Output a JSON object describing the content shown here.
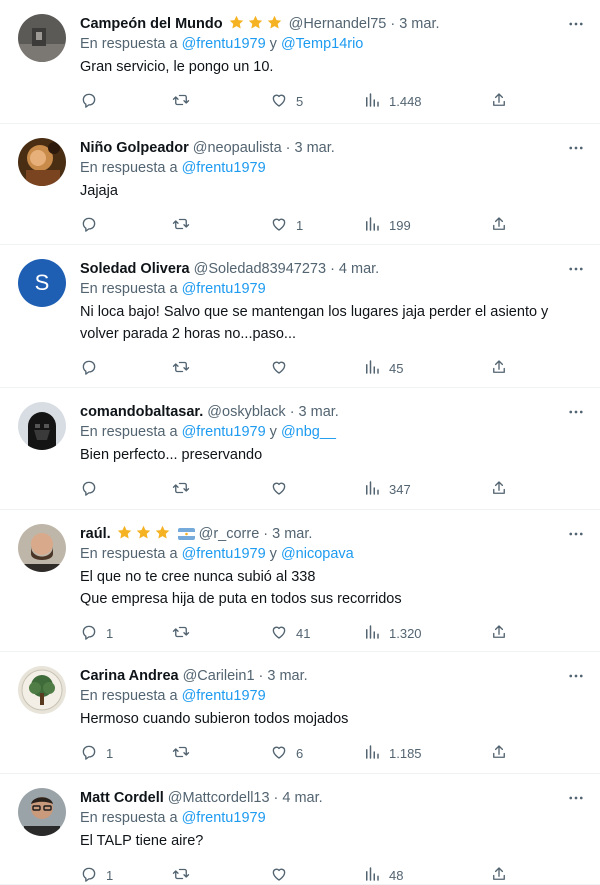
{
  "reply_prefix": "En respuesta a",
  "and_word": "y",
  "dot": "·",
  "tweets": [
    {
      "name": "Campeón del Mundo",
      "stars": 3,
      "flag": false,
      "handle": "@Hernandel75",
      "date": "3 mar.",
      "mention1": "@frentu1979",
      "mention2": "@Temp14rio",
      "text": [
        "Gran servicio, le pongo un 10."
      ],
      "replies": "",
      "retweets": "",
      "likes": "5",
      "views": "1.448",
      "avatar": "photo-dark-gray"
    },
    {
      "name": "Niño Golpeador",
      "stars": 0,
      "flag": false,
      "handle": "@neopaulista",
      "date": "3 mar.",
      "mention1": "@frentu1979",
      "mention2": "",
      "text": [
        "Jajaja"
      ],
      "replies": "",
      "retweets": "",
      "likes": "1",
      "views": "199",
      "avatar": "photo-painting"
    },
    {
      "name": "Soledad Olivera",
      "stars": 0,
      "flag": false,
      "handle": "@Soledad83947273",
      "date": "4 mar.",
      "mention1": "@frentu1979",
      "mention2": "",
      "text": [
        "Ni loca bajo! Salvo que se mantengan los lugares jaja perder el asiento y",
        "volver parada 2 horas no...paso..."
      ],
      "replies": "",
      "retweets": "",
      "likes": "",
      "views": "45",
      "avatar": "letter-S",
      "avatar_letter": "S"
    },
    {
      "name": "comandobaltasar.",
      "stars": 0,
      "flag": false,
      "handle": "@oskyblack",
      "date": "3 mar.",
      "mention1": "@frentu1979",
      "mention2": "@nbg__",
      "text": [
        "Bien perfecto... preservando"
      ],
      "replies": "",
      "retweets": "",
      "likes": "",
      "views": "347",
      "avatar": "photo-darth-vader"
    },
    {
      "name": "raúl.",
      "stars": 3,
      "flag": true,
      "handle": "@r_corre",
      "date": "3 mar.",
      "mention1": "@frentu1979",
      "mention2": "@nicopava",
      "text": [
        "El que no te cree nunca subió al 338",
        "Que empresa hija de puta en todos sus recorridos"
      ],
      "replies": "1",
      "retweets": "",
      "likes": "41",
      "views": "1.320",
      "avatar": "photo-bearded-man"
    },
    {
      "name": "Carina Andrea",
      "stars": 0,
      "flag": false,
      "handle": "@Carilein1",
      "date": "3 mar.",
      "mention1": "@frentu1979",
      "mention2": "",
      "text": [
        "Hermoso cuando subieron todos mojados"
      ],
      "replies": "1",
      "retweets": "",
      "likes": "6",
      "views": "1.185",
      "avatar": "photo-tree"
    },
    {
      "name": "Matt Cordell",
      "stars": 0,
      "flag": false,
      "handle": "@Mattcordell13",
      "date": "4 mar.",
      "mention1": "@frentu1979",
      "mention2": "",
      "text": [
        "El TALP tiene aire?"
      ],
      "replies": "1",
      "retweets": "",
      "likes": "",
      "views": "48",
      "avatar": "photo-man-glasses"
    }
  ],
  "colors": {
    "text": "#0f1419",
    "secondary": "#536471",
    "link": "#1d9bf0",
    "star": "#f5b324",
    "divider": "#eff3f4",
    "avatar_S": "#1e5fb4"
  },
  "icons": [
    "reply-icon",
    "retweet-icon",
    "like-icon",
    "views-icon",
    "share-icon",
    "more-icon",
    "star-icon",
    "argentina-flag-icon"
  ]
}
